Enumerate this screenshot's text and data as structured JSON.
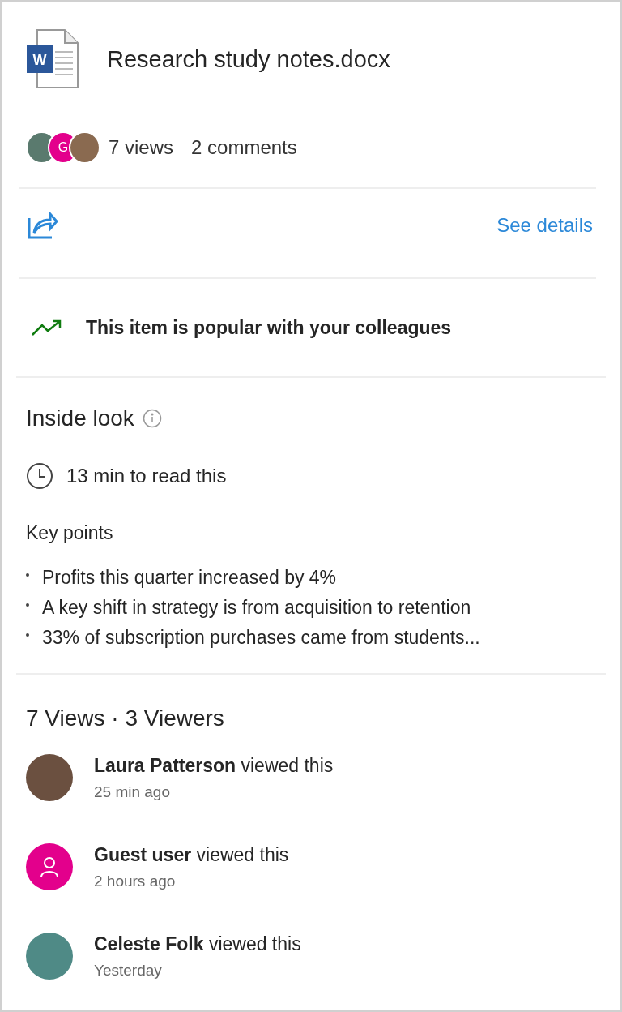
{
  "file": {
    "name": "Research study notes.docx",
    "icon_letter": "W"
  },
  "stats": {
    "avatars": [
      {
        "kind": "photo",
        "color": "#5a7a6e"
      },
      {
        "kind": "guest",
        "letter": "G",
        "color": "#e3008c"
      },
      {
        "kind": "photo",
        "color": "#8a6a50"
      }
    ],
    "views": "7 views",
    "comments": "2 comments"
  },
  "actions": {
    "details_link": "See details"
  },
  "popular": {
    "text": "This item is popular with your colleagues"
  },
  "inside_look": {
    "title": "Inside look",
    "read_time": "13 min to read this",
    "key_points_label": "Key points",
    "key_points": [
      "Profits this quarter increased by 4%",
      "A key shift in strategy is from acquisition to retention",
      "33% of subscription purchases came from students..."
    ]
  },
  "views": {
    "heading": "7 Views · 3 Viewers",
    "viewers": [
      {
        "kind": "photo",
        "color": "#6b5040",
        "text": "**Laura Patterson** viewed this",
        "time": "25 min ago"
      },
      {
        "kind": "guest",
        "color": "#e3008c",
        "text": "**Guest user** viewed this",
        "time": "2 hours ago"
      },
      {
        "kind": "photo",
        "color": "#4f8a86",
        "text": "**Celeste Folk** viewed this",
        "time": "Yesterday"
      }
    ]
  }
}
